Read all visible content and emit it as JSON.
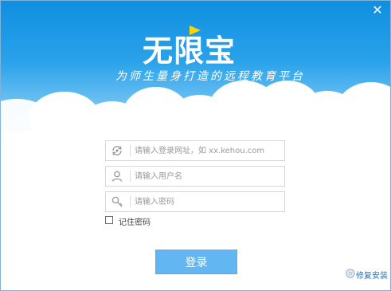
{
  "window": {
    "close_glyph": "✕"
  },
  "brand": {
    "app_title": "无限宝",
    "tagline": "为师生量身打造的远程教育平台"
  },
  "form": {
    "url_field": {
      "placeholder": "请输入登录网址，如 xx.kehou.com",
      "value": "",
      "icon": "refresh-link-icon"
    },
    "user_field": {
      "placeholder": "请输入用户名",
      "value": "",
      "icon": "user-icon"
    },
    "password_field": {
      "placeholder": "请输入密码",
      "value": "",
      "icon": "key-icon"
    },
    "remember_label": "记住密码",
    "remember_checked": false,
    "login_label": "登录"
  },
  "footer": {
    "repair_label": "修复安装",
    "repair_icon": "disc-icon"
  },
  "colors": {
    "sky_top": "#0f8fe0",
    "sky_bottom": "#a9d9f7",
    "button": "#62b7f3",
    "link": "#2a6fb0"
  }
}
